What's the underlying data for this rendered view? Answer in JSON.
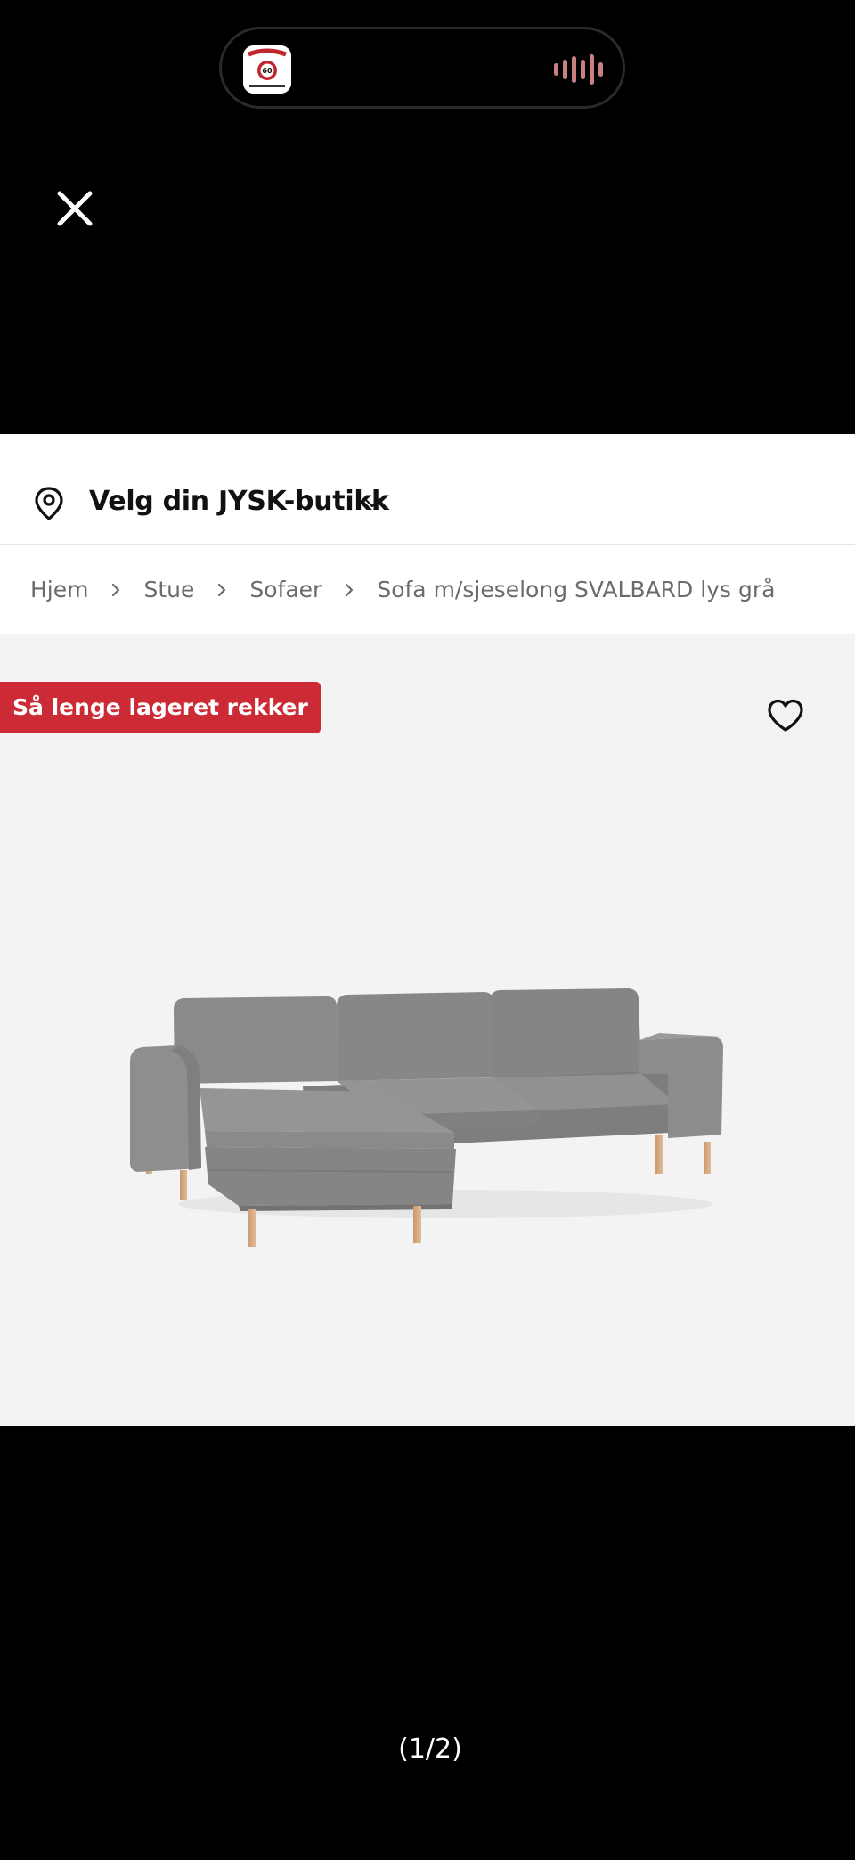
{
  "status_island": {
    "app_icon": "red-white-badge-app-icon",
    "app_icon_number": "60",
    "activity_icon": "audio-waveform-icon"
  },
  "viewer": {
    "close_icon": "close-icon",
    "image_counter": "(1/2)"
  },
  "store_selector": {
    "icon": "location-pin-icon",
    "label": "Velg din JYSK-butikk",
    "chevron": "chevron-down-icon"
  },
  "breadcrumb": {
    "items": [
      "Hjem",
      "Stue",
      "Sofaer",
      "Sofa m/sjeselong SVALBARD lys grå"
    ],
    "separator_icon": "chevron-right-icon"
  },
  "product": {
    "badge": "Så lenge lageret rekker",
    "favorite_icon": "heart-icon",
    "image": "grey-sofa-with-chaise-longue-image"
  },
  "colors": {
    "badge_red": "#cc2b36",
    "hero_bg": "#f3f3f3",
    "sofa_grey": "#8a8a8a"
  }
}
